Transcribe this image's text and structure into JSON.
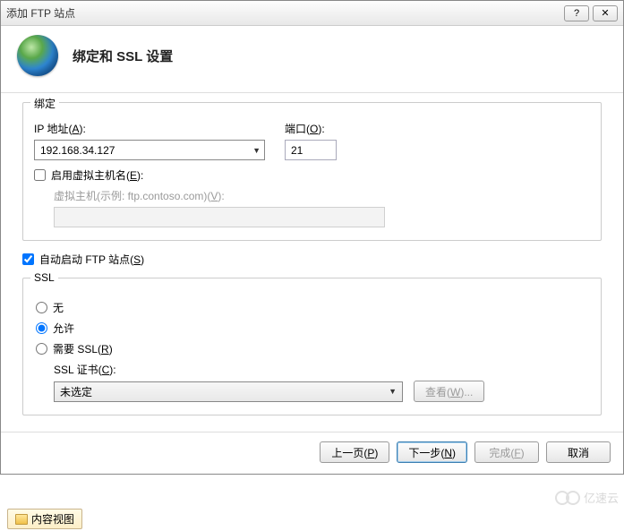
{
  "titlebar": {
    "title": "添加 FTP 站点",
    "help_icon": "?",
    "close_icon": "✕"
  },
  "header": {
    "title": "绑定和 SSL 设置"
  },
  "binding": {
    "legend": "绑定",
    "ip_label_pre": "IP 地址(",
    "ip_label_key": "A",
    "ip_label_post": "):",
    "ip_value": "192.168.34.127",
    "port_label_pre": "端口(",
    "port_label_key": "O",
    "port_label_post": "):",
    "port_value": "21",
    "vh_enable_pre": "启用虚拟主机名(",
    "vh_enable_key": "E",
    "vh_enable_post": "):",
    "vh_label_pre": "虚拟主机(示例: ftp.contoso.com)(",
    "vh_label_key": "V",
    "vh_label_post": "):",
    "vh_value": ""
  },
  "auto_start": {
    "label_pre": "自动启动 FTP 站点(",
    "label_key": "S",
    "label_post": ")"
  },
  "ssl": {
    "legend": "SSL",
    "none": "无",
    "allow": "允许",
    "require_pre": "需要 SSL(",
    "require_key": "R",
    "require_post": ")",
    "cert_label_pre": "SSL 证书(",
    "cert_label_key": "C",
    "cert_label_post": "):",
    "cert_value": "未选定",
    "view_pre": "查看(",
    "view_key": "W",
    "view_post": ")..."
  },
  "footer": {
    "prev_pre": "上一页(",
    "prev_key": "P",
    "prev_post": ")",
    "next_pre": "下一步(",
    "next_key": "N",
    "next_post": ")",
    "finish_pre": "完成(",
    "finish_key": "F",
    "finish_post": ")",
    "cancel": "取消"
  },
  "bottom_tab": {
    "label": "内容视图"
  },
  "watermark": "亿速云"
}
